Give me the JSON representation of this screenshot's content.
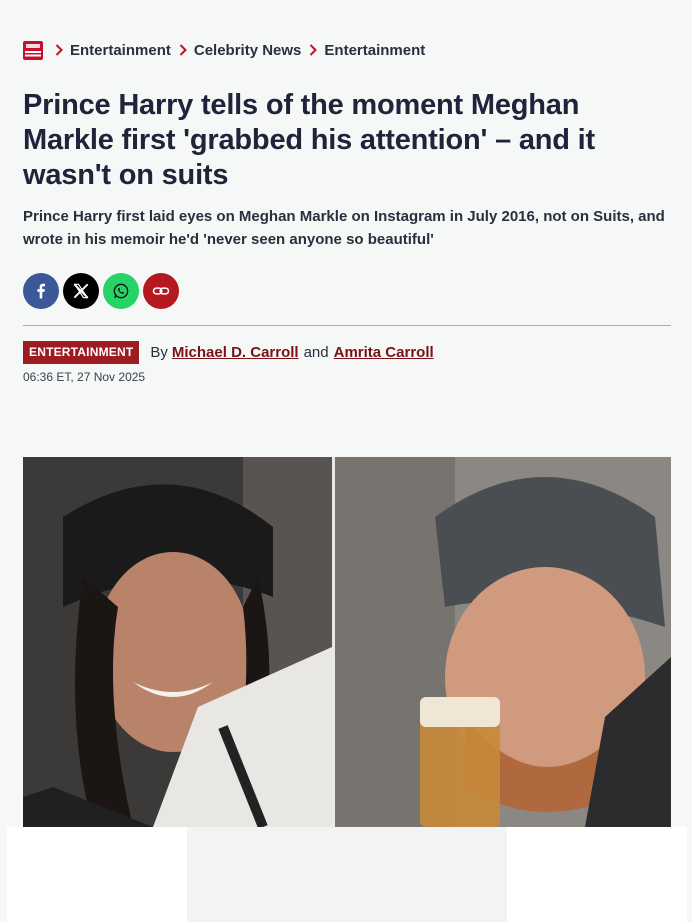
{
  "breadcrumb": {
    "items": [
      "Entertainment",
      "Celebrity News",
      "Entertainment"
    ]
  },
  "article": {
    "headline": "Prince Harry tells of the moment Meghan Markle first 'grabbed his attention' – and it wasn't on suits",
    "standfirst": "Prince Harry first laid eyes on Meghan Markle on Instagram in July 2016, not on Suits, and wrote in his memoir he'd 'never seen anyone so beautiful'",
    "category_tag": "ENTERTAINMENT",
    "by_label": "By",
    "authors": [
      "Michael D. Carroll",
      "Amrita Carroll"
    ],
    "and_label": "and",
    "timestamp": "06:36 ET, 27 Nov 2025"
  },
  "share": {
    "buttons": [
      {
        "icon": "facebook-icon",
        "color": "#3b5998"
      },
      {
        "icon": "x-icon",
        "color": "#000000"
      },
      {
        "icon": "whatsapp-icon",
        "color": "#25d366"
      },
      {
        "icon": "link-icon",
        "color": "#b5191f"
      }
    ]
  },
  "colors": {
    "brand_red": "#9e1b22",
    "author_link": "#7a1116",
    "headline": "#20243a"
  }
}
